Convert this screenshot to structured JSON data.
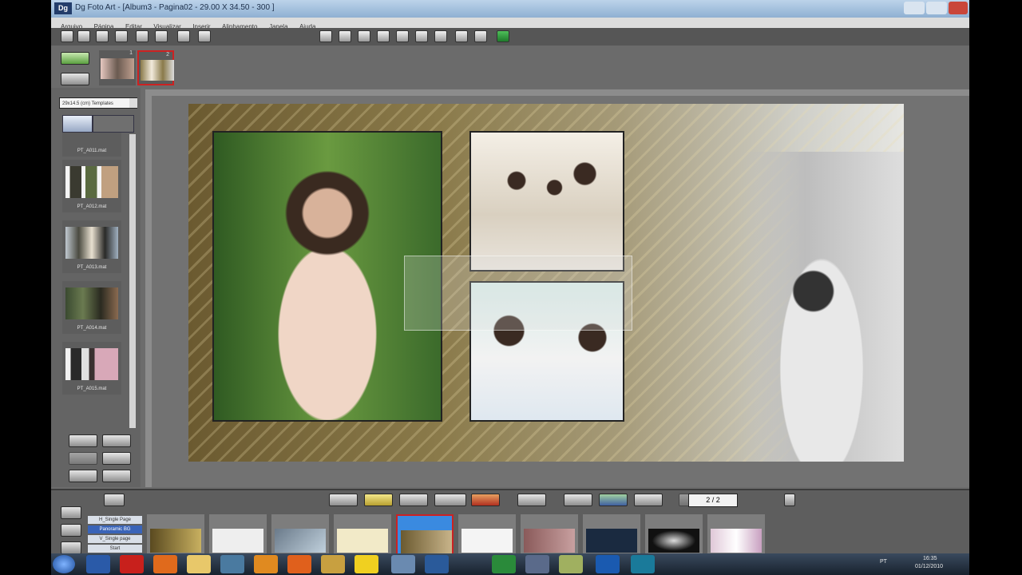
{
  "window": {
    "title": "Dg Foto Art - [Album3 - Pagina02 - 29.00 X 34.50 - 300 ]",
    "logo_text": "Dg"
  },
  "menu": [
    "Arquivo",
    "Página",
    "Editar",
    "Visualizar",
    "Inserir",
    "Alinhamento",
    "Janela",
    "Ajuda"
  ],
  "left_panel": {
    "template_select": "29x14.5 (cm) Templates",
    "templates": [
      {
        "label": "PT_A011.mat"
      },
      {
        "label": "PT_A012.mat"
      },
      {
        "label": "PT_A013.mat"
      },
      {
        "label": "PT_A014.mat"
      },
      {
        "label": "PT_A015.mat"
      }
    ]
  },
  "page_thumbs": [
    {
      "num": "1"
    },
    {
      "num": "2"
    }
  ],
  "bottom_panel": {
    "pager": "2 / 2",
    "background_options": [
      "H_Single Page",
      "Panoramic BG",
      "V_Single page",
      "Start"
    ]
  },
  "taskbar": {
    "language": "PT",
    "time": "16:35",
    "date": "01/12/2010"
  },
  "colors": {
    "accent_selected": "#cc2222",
    "titlebar": "#9fbde0"
  }
}
